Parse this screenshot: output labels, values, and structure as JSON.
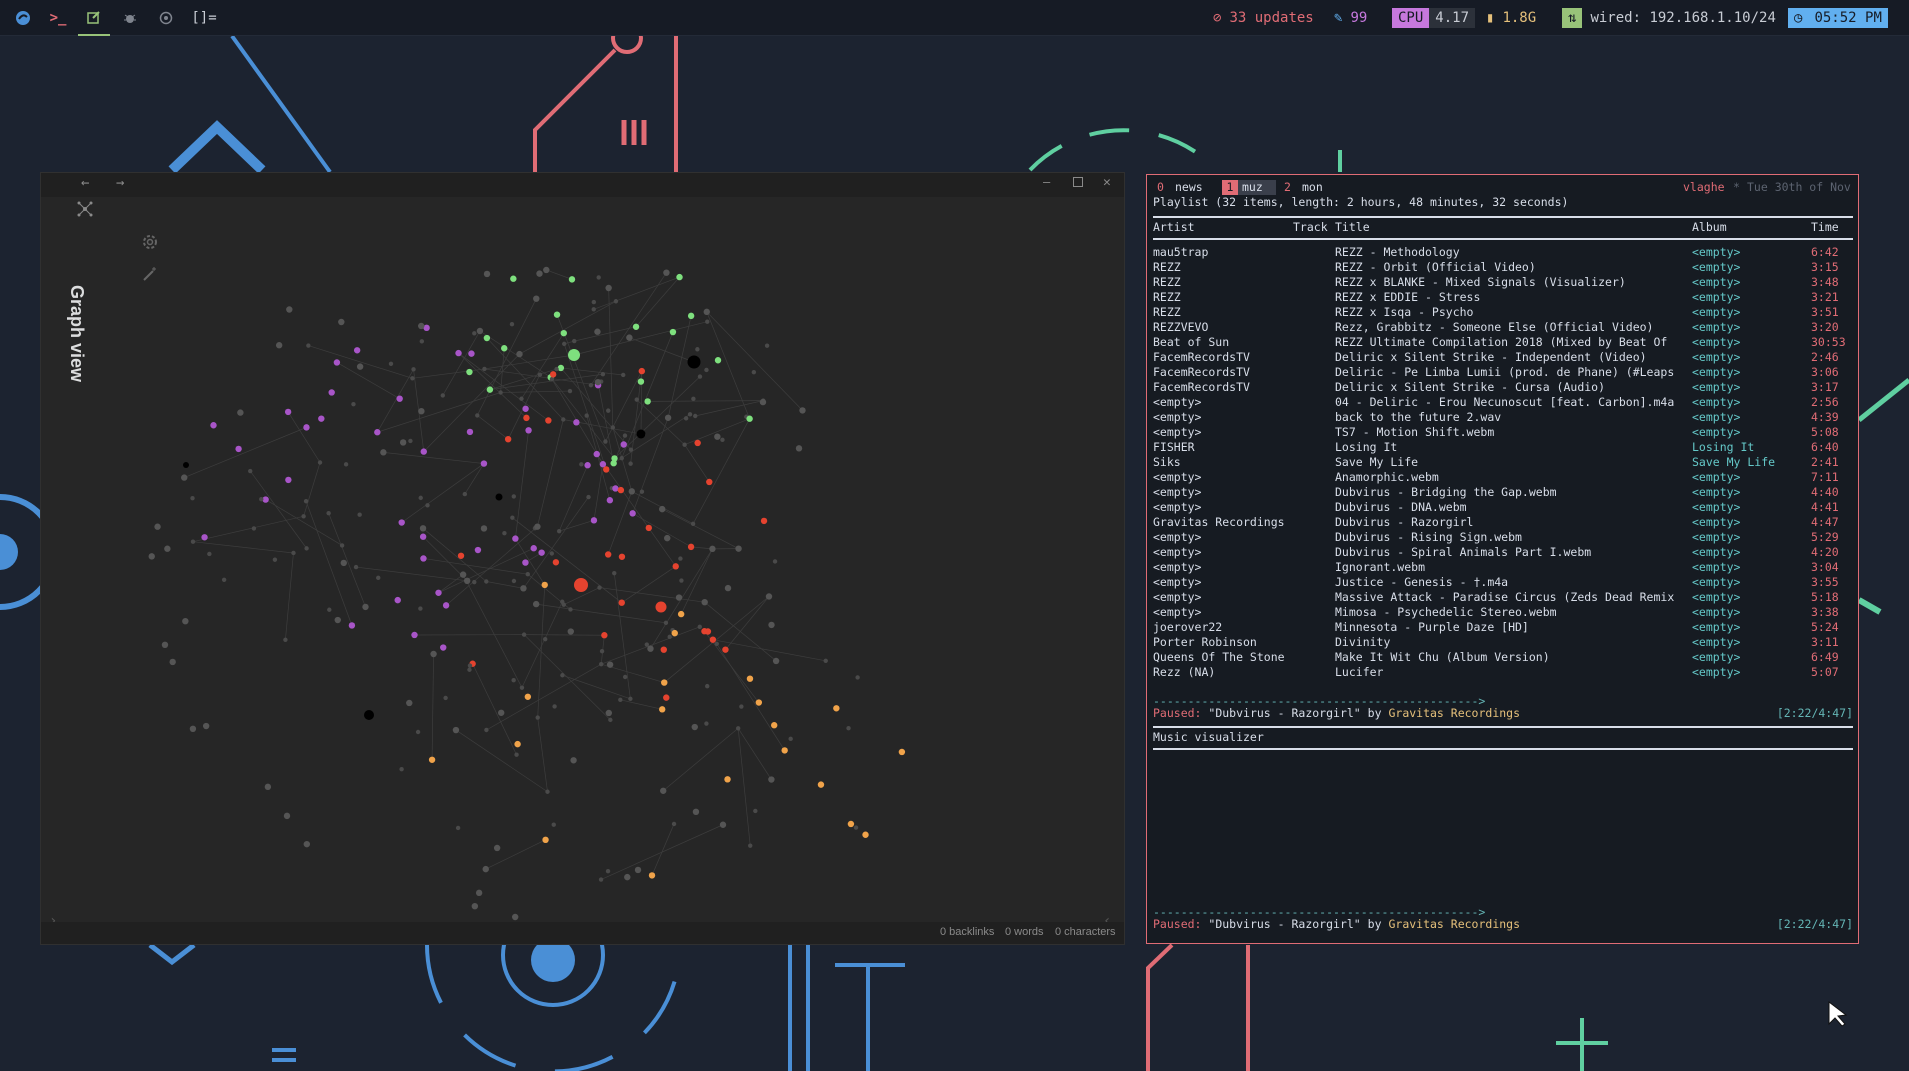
{
  "topbar": {
    "workspace_icons": [
      "arch-logo-icon",
      "terminal-icon",
      "editor-icon",
      "bug-icon",
      "network-icon"
    ],
    "layout_symbol": "[]=",
    "updates": "33 updates",
    "brightness": "99",
    "cpu_label": "CPU",
    "cpu_value": "4.17",
    "mem_value": "1.8G",
    "network": "wired: 192.168.1.10/24",
    "clock": "05:52 PM",
    "colors": {
      "updates": "#e06c75",
      "cpu_badge": "#c678dd",
      "net_badge": "#98c379",
      "clock_badge": "#61afef"
    }
  },
  "obsidian": {
    "nav_back": "←",
    "nav_forward": "→",
    "title": "Graph view",
    "status": {
      "backlinks": "0 backlinks",
      "words": "0 words",
      "characters": "0 characters"
    }
  },
  "ncmpcpp": {
    "tabs": [
      {
        "num": "0",
        "label": "news"
      },
      {
        "num": "1",
        "label": "muz"
      },
      {
        "num": "2",
        "label": "mon"
      }
    ],
    "user": "vlaghe",
    "date": "Tue 30th of Nov",
    "playlist_info": "Playlist (32 items, length: 2 hours, 48 minutes, 32 seconds)",
    "columns": {
      "artist": "Artist",
      "track": "Track",
      "title": "Title",
      "album": "Album",
      "time": "Time"
    },
    "rows": [
      {
        "artist": "mau5trap",
        "title": "REZZ - Methodology",
        "album": "<empty>",
        "time": "6:42"
      },
      {
        "artist": "REZZ",
        "title": "REZZ - Orbit (Official Video)",
        "album": "<empty>",
        "time": "3:15"
      },
      {
        "artist": "REZZ",
        "title": "REZZ x BLANKE -  Mixed Signals (Visualizer)",
        "album": "<empty>",
        "time": "3:48"
      },
      {
        "artist": "REZZ",
        "title": "REZZ x EDDIE - Stress",
        "album": "<empty>",
        "time": "3:21"
      },
      {
        "artist": "REZZ",
        "title": "REZZ x Isqa -  Psycho",
        "album": "<empty>",
        "time": "3:51"
      },
      {
        "artist": "REZZVEVO",
        "title": "Rezz, Grabbitz - Someone Else (Official Video)",
        "album": "<empty>",
        "time": "3:20"
      },
      {
        "artist": "Beat of Sun",
        "title": "REZZ Ultimate Compilation 2018 (Mixed by Beat Of",
        "album": "<empty>",
        "time": "30:53"
      },
      {
        "artist": "FacemRecordsTV",
        "title": "Deliric x Silent Strike - Independent (Video)",
        "album": "<empty>",
        "time": "2:46"
      },
      {
        "artist": "FacemRecordsTV",
        "title": "Deliric - Pe Limba Lumii (prod. de Phane) (#Leaps",
        "album": "<empty>",
        "time": "3:06"
      },
      {
        "artist": "FacemRecordsTV",
        "title": "Deliric x Silent Strike - Cursa (Audio)",
        "album": "<empty>",
        "time": "3:17"
      },
      {
        "artist": "<empty>",
        "title": "04 - Deliric - Erou Necunoscut [feat. Carbon].m4a",
        "album": "<empty>",
        "time": "2:56"
      },
      {
        "artist": "<empty>",
        "title": "back to the future 2.wav",
        "album": "<empty>",
        "time": "4:39"
      },
      {
        "artist": "<empty>",
        "title": "TS7 - Motion Shift.webm",
        "album": "<empty>",
        "time": "5:08"
      },
      {
        "artist": "FISHER",
        "title": "Losing It",
        "album": "Losing It",
        "time": "6:40"
      },
      {
        "artist": "Siks",
        "title": "Save My Life",
        "album": "Save My Life",
        "time": "2:41"
      },
      {
        "artist": "<empty>",
        "title": "Anamorphic.webm",
        "album": "<empty>",
        "time": "7:11"
      },
      {
        "artist": "<empty>",
        "title": "Dubvirus - Bridging the Gap.webm",
        "album": "<empty>",
        "time": "4:40"
      },
      {
        "artist": "<empty>",
        "title": "Dubvirus - DNA.webm",
        "album": "<empty>",
        "time": "4:41"
      },
      {
        "artist": "Gravitas Recordings",
        "title": "Dubvirus - Razorgirl",
        "album": "<empty>",
        "time": "4:47"
      },
      {
        "artist": "<empty>",
        "title": "Dubvirus - Rising Sign.webm",
        "album": "<empty>",
        "time": "5:29"
      },
      {
        "artist": "<empty>",
        "title": "Dubvirus - Spiral Animals Part I.webm",
        "album": "<empty>",
        "time": "4:20"
      },
      {
        "artist": "<empty>",
        "title": "Ignorant.webm",
        "album": "<empty>",
        "time": "3:04"
      },
      {
        "artist": "<empty>",
        "title": "Justice - Genesis - †.m4a",
        "album": "<empty>",
        "time": "3:55"
      },
      {
        "artist": "<empty>",
        "title": "Massive Attack - Paradise Circus (Zeds Dead Remix",
        "album": "<empty>",
        "time": "5:18"
      },
      {
        "artist": "<empty>",
        "title": "Mimosa - Psychedelic Stereo.webm",
        "album": "<empty>",
        "time": "3:38"
      },
      {
        "artist": "joerover22",
        "title": "Minnesota - Purple Daze [HD]",
        "album": "<empty>",
        "time": "5:24"
      },
      {
        "artist": "Porter Robinson",
        "title": "Divinity",
        "album": "<empty>",
        "time": "3:11"
      },
      {
        "artist": "Queens Of The Stone",
        "title": "Make It Wit Chu (Album Version)",
        "album": "<empty>",
        "time": "6:49"
      },
      {
        "artist": "Rezz (NA)",
        "title": "Lucifer",
        "album": "<empty>",
        "time": "5:07"
      }
    ],
    "progress_bar": "----------------------------------------------->",
    "status": {
      "state": "Paused:",
      "song": "\"Dubvirus - Razorgirl\"",
      "by": "by",
      "artist": "Gravitas Recordings",
      "elapsed": "[2:22/4:47]"
    },
    "visualizer_title": "Music visualizer"
  }
}
